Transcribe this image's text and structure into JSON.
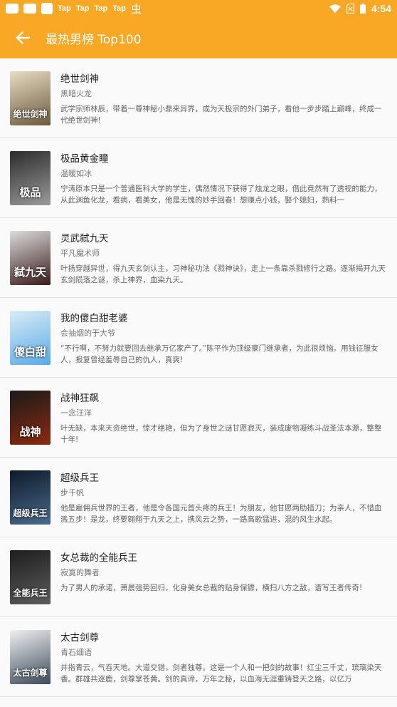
{
  "status_bar": {
    "tap_labels": [
      "Tap",
      "Tap",
      "Tap",
      "Tap"
    ],
    "bug_glyph": "虫",
    "time": "4:54"
  },
  "header": {
    "title": "最热男榜 Top100",
    "back_icon": "arrow-left-icon",
    "background": "#f9a825"
  },
  "books": [
    {
      "title": "绝世剑神",
      "author": "黑暗火龙",
      "description": "武学宗师林辰，带着一尊神秘小鼎来异界，成为天极宗的外门弟子，看他一步步踏上巅峰，终成一代绝世剑神!",
      "cover_text": "绝世剑神",
      "cover_colors": [
        "#e8dcc4",
        "#6b5a3c"
      ]
    },
    {
      "title": "极品黄金瞳",
      "author": "温暖如冰",
      "description": "宁涛原本只是一个普通医科大学的学生，偶然情况下获得了烛龙之眼，借此竟然有了透视的能力，从此渊鱼化龙，看病，看美女，他是无愧的妙手回春！想赚点小钱，娶个媳妇，熟料一",
      "cover_text": "极品",
      "cover_colors": [
        "#2c2c2c",
        "#9a9a9a"
      ]
    },
    {
      "title": "灵武弑九天",
      "author": "平凡魔术师",
      "description": "叶扬穿越异世，得九天玄剑认主，习神秘功法《戮神诀》，走上一条靠杀戮修行之路。逐渐揭开九天玄剑陨落之谜，杀上神界，血染九天。",
      "cover_text": "弑九天",
      "cover_colors": [
        "#dcdcdc",
        "#3a1a1a"
      ]
    },
    {
      "title": "我的傻白甜老婆",
      "author": "会抽烟的于大爷",
      "description": "“不行啊，不努力就要回去继承万亿家产了。”陈平作为顶级豪门继承者，为此很烦恼。用钱征服女人，报复曾经羞辱自己的仇人，真爽!",
      "cover_text": "傻白甜",
      "cover_colors": [
        "#d8ecf6",
        "#5aa9e6"
      ]
    },
    {
      "title": "战神狂飙",
      "author": "一念汪洋",
      "description": "叶无缺，本来天资绝世，惊才绝艳，但为了身世之谜甘愿寂灭，装成废物凝练斗战圣法本源，整整十年!",
      "cover_text": "战神",
      "cover_colors": [
        "#1a1a1a",
        "#8b2a10"
      ]
    },
    {
      "title": "超级兵王",
      "author": "步千帆",
      "description": "他是雇佣兵世界的王者，他是令各国元首头疼的兵王！为朋友，他甘愿两肋插刀；为亲人，不惜血溅五步！是龙，终要翱翔于九天之上，携风云之势，一路高歌猛进，混的风生水起。",
      "cover_text": "超级兵王",
      "cover_colors": [
        "#0e1a2a",
        "#4a6a8a"
      ]
    },
    {
      "title": "女总裁的全能兵王",
      "author": "寂寞的舞者",
      "description": "为了男人的承诺，萧晨强势回归，化身美女总裁的贴身保镖，横扫八方之敌，谱写王者传奇!",
      "cover_text": "全能兵王",
      "cover_colors": [
        "#1e1e1e",
        "#5c5c5c"
      ]
    },
    {
      "title": "太古剑尊",
      "author": "青石细语",
      "description": "并指青云，气吞天地。大道交错，剑者独尊。这是一个人和一把剑的故事！红尘三千丈，琉璃染天香。群雄共逐鹿，剑尊掌苍黄。剑的真谛，万年之秘，以血海无涯重铸登天之路，以亿万",
      "cover_text": "太古剑尊",
      "cover_colors": [
        "#f0f0f0",
        "#3c4a5a"
      ]
    }
  ]
}
